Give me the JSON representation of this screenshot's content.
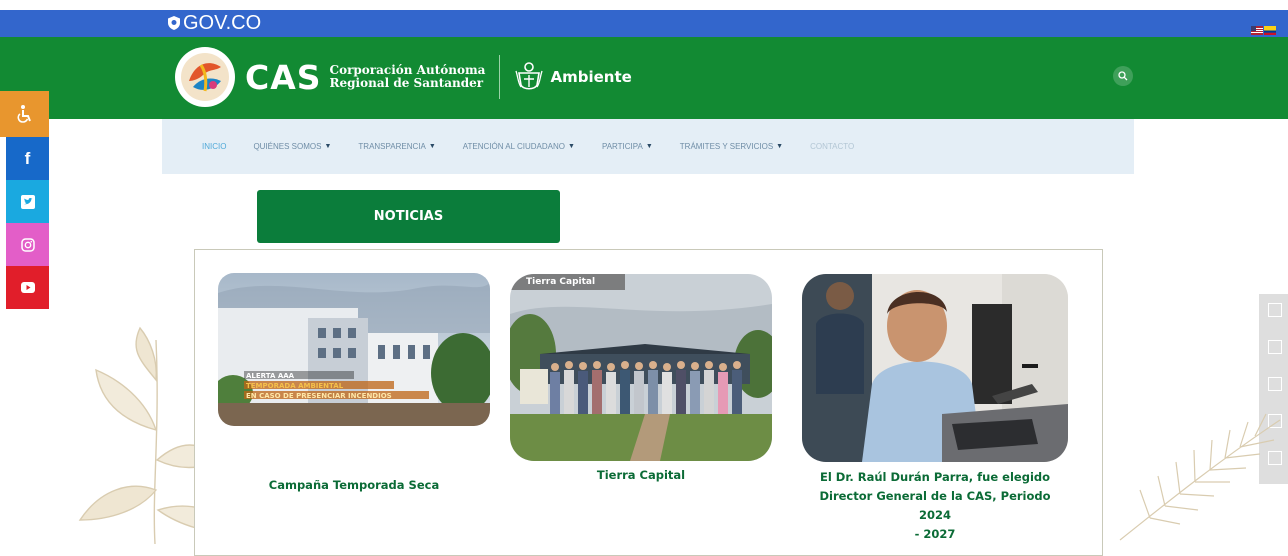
{
  "gov_bar": {
    "logo_text": "GOV.CO"
  },
  "header": {
    "brand_short": "CAS",
    "brand_line1": "Corporación Autónoma",
    "brand_line2": "Regional de Santander",
    "ministry": "Ambiente"
  },
  "nav": {
    "items": [
      {
        "label": "Inicio",
        "dropdown": false
      },
      {
        "label": "Quiénes somos",
        "dropdown": true
      },
      {
        "label": "Transparencia",
        "dropdown": true
      },
      {
        "label": "Atención al ciudadano",
        "dropdown": true
      },
      {
        "label": "Participa",
        "dropdown": true
      },
      {
        "label": "Trámites y servicios",
        "dropdown": true
      },
      {
        "label": "Contacto",
        "dropdown": false
      }
    ]
  },
  "section": {
    "button_label": "NOTICIAS"
  },
  "news": [
    {
      "title": "Campaña Temporada Seca",
      "overlay_line1": "ALERTA AAA",
      "overlay_line2": "TEMPORADA AMBIENTAL",
      "overlay_line3": "EN CASO DE PRESENCIAR INCENDIOS"
    },
    {
      "tag": "Tierra Capital",
      "title": "Tierra Capital"
    },
    {
      "title_line1": "El Dr. Raúl Durán Parra, fue elegido",
      "title_line2": "Director General de la CAS, Periodo 2024",
      "title_line3": "- 2027"
    }
  ],
  "colors": {
    "gov_blue": "#3366cc",
    "header_green": "#128a33",
    "nav_bg": "#e4eef6",
    "button_green": "#0b7d3b",
    "title_green": "#0b6b36",
    "facebook": "#1769c9",
    "twitter": "#1aa9e0",
    "instagram": "#e35ec8",
    "youtube": "#e11e2a",
    "accessibility": "#e8962e"
  },
  "icons": [
    "shield-icon",
    "flag-icon",
    "search-icon",
    "ministry-emblem-icon",
    "accessibility-icon",
    "facebook-icon",
    "twitter-icon",
    "instagram-icon",
    "youtube-icon",
    "chevron-down-icon"
  ]
}
